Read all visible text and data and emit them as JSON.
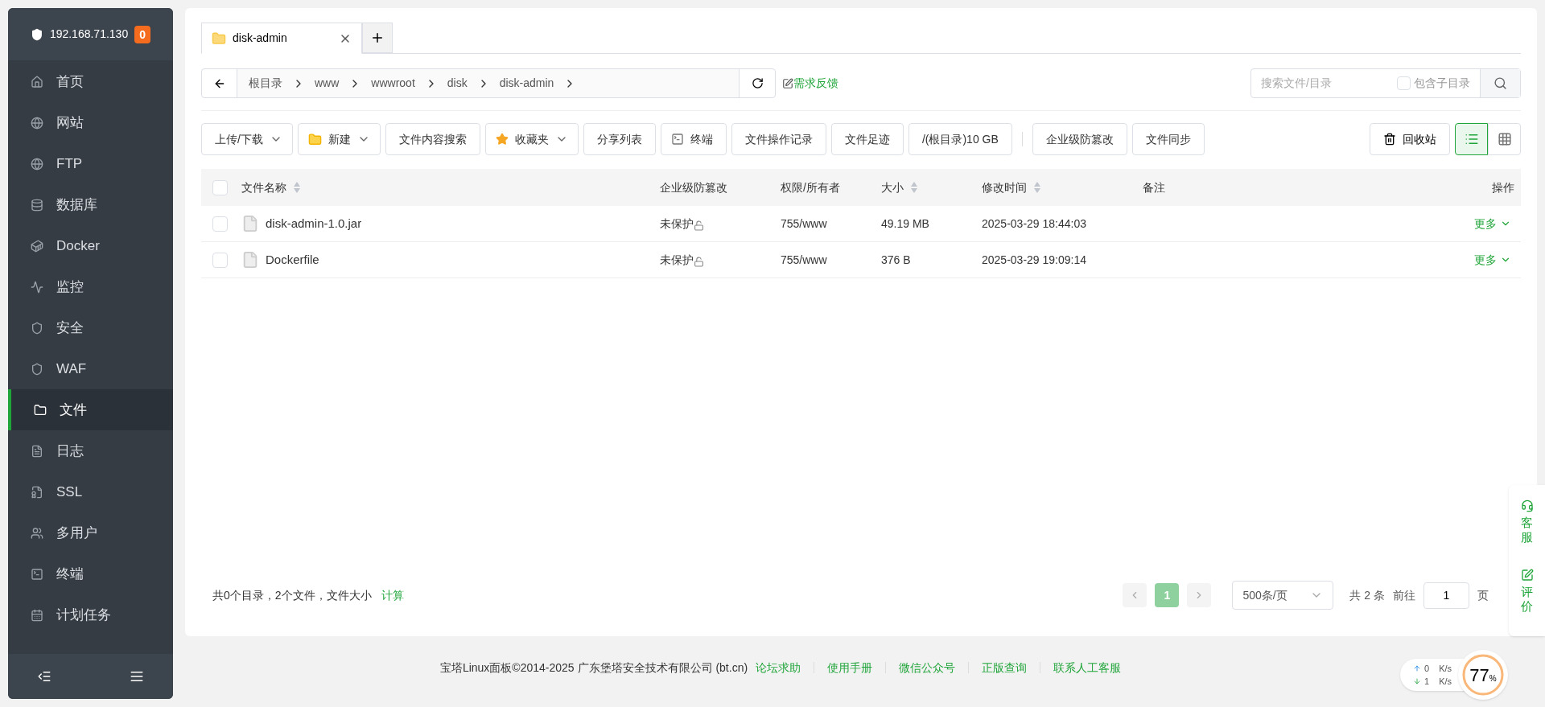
{
  "sidebar": {
    "host": "192.168.71.130",
    "badge": "0",
    "items": [
      {
        "label": "首页",
        "selected": false
      },
      {
        "label": "网站",
        "selected": false
      },
      {
        "label": "FTP",
        "selected": false
      },
      {
        "label": "数据库",
        "selected": false
      },
      {
        "label": "Docker",
        "selected": false
      },
      {
        "label": "监控",
        "selected": false
      },
      {
        "label": "安全",
        "selected": false
      },
      {
        "label": "WAF",
        "selected": false
      },
      {
        "label": "文件",
        "selected": true
      },
      {
        "label": "日志",
        "selected": false
      },
      {
        "label": "SSL",
        "selected": false
      },
      {
        "label": "多用户",
        "selected": false
      },
      {
        "label": "终端",
        "selected": false
      },
      {
        "label": "计划任务",
        "selected": false
      }
    ]
  },
  "tabs": [
    {
      "label": "disk-admin",
      "selected": true
    }
  ],
  "breadcrumb": [
    "根目录",
    "www",
    "wwwroot",
    "disk",
    "disk-admin"
  ],
  "feedback_link": "需求反馈",
  "search": {
    "placeholder": "搜索文件/目录",
    "include_subdirs_label": "包含子目录",
    "include_subdirs": false
  },
  "toolbar": [
    {
      "label": "上传/下载",
      "kind": "plain",
      "dropdown": true
    },
    {
      "label": "新建",
      "kind": "new",
      "dropdown": true
    },
    {
      "label": "文件内容搜索",
      "kind": "plain",
      "dropdown": false
    },
    {
      "label": "收藏夹",
      "kind": "favorites",
      "dropdown": true
    },
    {
      "label": "分享列表",
      "kind": "plain",
      "dropdown": false
    },
    {
      "label": "终端",
      "kind": "terminal",
      "dropdown": false
    },
    {
      "label": "文件操作记录",
      "kind": "plain",
      "dropdown": false
    },
    {
      "label": "文件足迹",
      "kind": "plain",
      "dropdown": false
    },
    {
      "label": "/(根目录)10 GB",
      "kind": "plain",
      "dropdown": false
    }
  ],
  "toolbar_extra": [
    "企业级防篡改",
    "文件同步"
  ],
  "recycle_bin": "回收站",
  "view_modes": [
    {
      "kind": "list",
      "selected": true
    },
    {
      "kind": "grid",
      "selected": false
    }
  ],
  "table": {
    "all_checked": false,
    "columns": [
      {
        "label": "文件名称",
        "sortable": true
      },
      {
        "label": "企业级防篡改",
        "sortable": false
      },
      {
        "label": "权限/所有者",
        "sortable": false
      },
      {
        "label": "大小",
        "sortable": true
      },
      {
        "label": "修改时间",
        "sortable": true
      },
      {
        "label": "备注",
        "sortable": false
      },
      {
        "label": "操作",
        "sortable": false
      }
    ],
    "rows": [
      {
        "name": "disk-admin-1.0.jar",
        "protect": "未保护",
        "perms": "755/www",
        "size": "49.19 MB",
        "modified": "2025-03-29 18:44:03",
        "action": "更多",
        "checked": false
      },
      {
        "name": "Dockerfile",
        "protect": "未保护",
        "perms": "755/www",
        "size": "376 B",
        "modified": "2025-03-29 19:09:14",
        "action": "更多",
        "checked": false
      }
    ]
  },
  "summary": {
    "text": "共0个目录，2个文件，文件大小",
    "link": "计算"
  },
  "pagination": {
    "pages": [
      {
        "label": "1",
        "selected": true
      }
    ],
    "page_size": "500条/页",
    "total": "共 2 条",
    "goto_label": "前往",
    "goto_value": "1",
    "page_label": "页"
  },
  "footer": {
    "copyright": "宝塔Linux面板©2014-2025 广东堡塔安全技术有限公司 (bt.cn)",
    "links": [
      "论坛求助",
      "使用手册",
      "微信公众号",
      "正版查询",
      "联系人工客服"
    ]
  },
  "side_float": [
    {
      "label": "客服",
      "kind": "support"
    },
    {
      "label": "评价",
      "kind": "review"
    }
  ],
  "status_widget": {
    "upload": "0",
    "upload_unit": "K/s",
    "download": "1",
    "download_unit": "K/s",
    "value": "77",
    "percent_sign": "%"
  }
}
